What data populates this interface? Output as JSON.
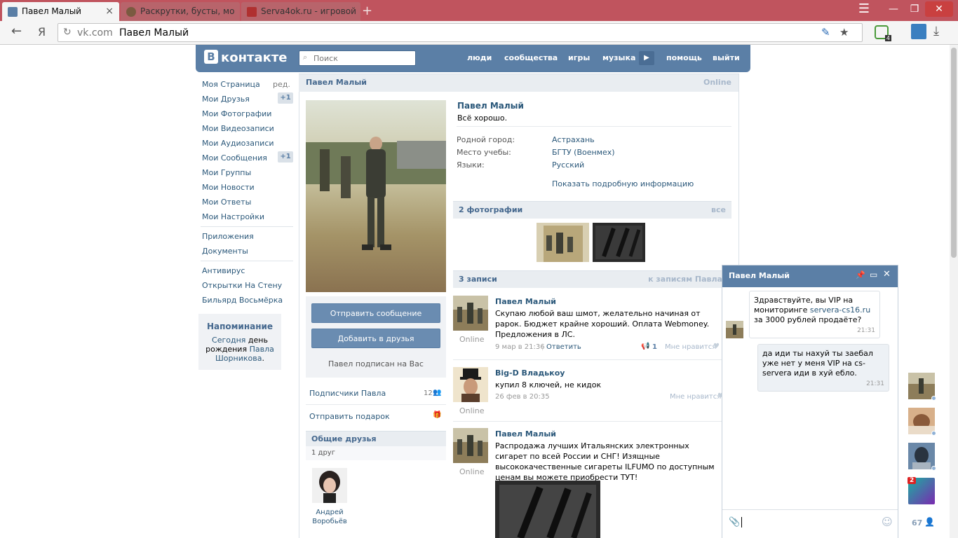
{
  "browser": {
    "tabs": [
      {
        "title": "Павел Малый",
        "active": true
      },
      {
        "title": "Раскрутки, бусты, мо",
        "active": false
      },
      {
        "title": "Serva4ok.ru - игровой",
        "active": false
      }
    ],
    "address_host": "vk.com",
    "address_query": "Павел Малый",
    "yandex_label": "Я",
    "ext_badge": "4"
  },
  "vk": {
    "logo": "контакте",
    "logo_letter": "В",
    "search_placeholder": "Поиск",
    "nav": [
      "люди",
      "сообщества",
      "игры",
      "музыка",
      "помощь",
      "выйти"
    ]
  },
  "menu": {
    "items": [
      {
        "label": "Моя Страница",
        "extra": "ред."
      },
      {
        "label": "Мои Друзья",
        "badge": "+1"
      },
      {
        "label": "Мои Фотографии"
      },
      {
        "label": "Мои Видеозаписи"
      },
      {
        "label": "Мои Аудиозаписи"
      },
      {
        "label": "Мои Сообщения",
        "badge": "+1"
      },
      {
        "label": "Мои Группы"
      },
      {
        "label": "Мои Новости"
      },
      {
        "label": "Мои Ответы"
      },
      {
        "label": "Мои Настройки"
      }
    ],
    "apps": [
      "Приложения",
      "Документы"
    ],
    "games": [
      "Антивирус",
      "Открытки На Стену",
      "Бильярд Восьмёрка"
    ],
    "reminder": {
      "title": "Напоминание",
      "pre": "Сегодня",
      "mid": "день рождения",
      "link": "Павла Шорникова",
      "post": "."
    }
  },
  "profile": {
    "bar_name": "Павел Малый",
    "bar_status": "Online",
    "name": "Павел Малый",
    "status": "Всё хорошо.",
    "info": [
      {
        "label": "Родной город:",
        "value": "Астрахань"
      },
      {
        "label": "Место учебы:",
        "value": "БГТУ (Военмех)"
      },
      {
        "label": "Языки:",
        "value": "Русский"
      }
    ],
    "show_more": "Показать подробную информацию",
    "btn_message": "Отправить сообщение",
    "btn_friend": "Добавить в друзья",
    "subscribed": "Павел подписан на Вас",
    "followers_label": "Подписчики Павла",
    "followers_count": "12",
    "gift_label": "Отправить подарок",
    "common_friends_title": "Общие друзья",
    "common_friends_count": "1 друг",
    "friend_name": "Андрей Воробьёв",
    "photos_title": "2 фотографии",
    "photos_all": "все",
    "wall_title": "3 записи",
    "wall_link": "к записям Павла"
  },
  "posts": [
    {
      "author": "Павел Малый",
      "online": "Online",
      "text": "Скупаю любой ваш шмот, желательно начиная от рарок. Бюджет крайне хороший. Оплата Webmoney. Предложения в ЛС.",
      "date": "9 мар в 21:36",
      "reply": "Ответить",
      "reposts": "1",
      "like": "Мне нравится"
    },
    {
      "author": "Big-D Владькоу",
      "online": "Online",
      "text": "купил 8 ключей, не кидок",
      "date": "26 фев в 20:35",
      "like": "Мне нравится"
    },
    {
      "author": "Павел Малый",
      "online": "Online",
      "text": "Распродажа лучших Итальянских электронных сигарет по всей России и СНГ! Изящные высококачественные сигареты ILFUMO по доступным ценам вы можете приобрести ТУТ!"
    }
  ],
  "chat": {
    "title": "Павел Малый",
    "msg1_pre": "Здравствуйте, вы VIP на мониторинге ",
    "msg1_link": "servera-cs16.ru",
    "msg1_post": " за 3000 рублей продаёте?",
    "msg1_time": "21:31",
    "msg2": "да иди ты нахуй ты заебал уже нет у меня VIP на cs-servera иди в хуй ебло.",
    "msg2_time": "21:31"
  },
  "dock": {
    "badge": "2",
    "online_count": "67"
  },
  "colors": {
    "vk_blue": "#5b7fa6",
    "link": "#2b587a",
    "tabbar": "#c0545e"
  }
}
